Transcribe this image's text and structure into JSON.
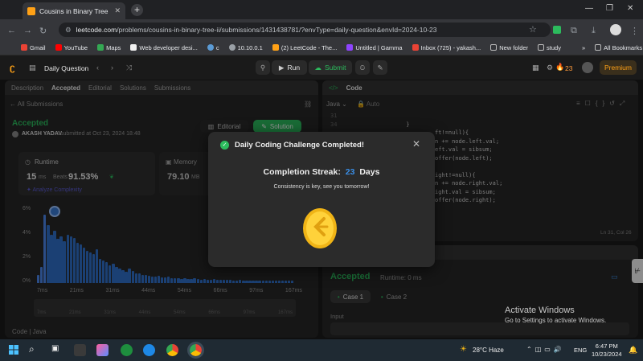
{
  "browser": {
    "tab_title": "Cousins in Binary Tree II - LeetC",
    "url_host": "leetcode.com",
    "url_path": "/problems/cousins-in-binary-tree-ii/submissions/1431438781/?envType=daily-question&envId=2024-10-23",
    "bookmarks": [
      "Gmail",
      "YouTube",
      "Maps",
      "Web developer desi...",
      "c",
      "10.10.0.1",
      "(2) LeetCode - The...",
      "Untitled | Gamma",
      "Inbox (725) - yakash...",
      "New folder",
      "study"
    ],
    "all_bookmarks": "All Bookmarks"
  },
  "header": {
    "daily_question": "Daily Question",
    "run": "Run",
    "submit": "Submit",
    "streak_count": "23",
    "premium": "Premium"
  },
  "left_panel": {
    "tabs": [
      "Description",
      "Accepted",
      "Editorial",
      "Solutions",
      "Submissions"
    ],
    "all_submissions": "All Submissions",
    "status": "Accepted",
    "user": "AKASH YADAV",
    "submitted_text": "submitted at Oct 23, 2024 18:48",
    "editorial_btn": "Editorial",
    "solution_btn": "Solution",
    "runtime_label": "Runtime",
    "runtime_value": "15",
    "runtime_unit": "ms",
    "beats_label": "Beats",
    "beats_value": "91.53%",
    "memory_label": "Memory",
    "memory_value": "79.10",
    "memory_unit": "MB",
    "analyze": "Analyze Complexity",
    "y_ticks": [
      "6%",
      "4%",
      "2%",
      "0%"
    ],
    "x_ticks": [
      "7ms",
      "21ms",
      "31ms",
      "44ms",
      "54ms",
      "66ms",
      "97ms",
      "167ms"
    ],
    "bottom_label": "Code | Java"
  },
  "editor": {
    "title": "Code",
    "language": "Java",
    "auto": "Auto",
    "lines": [
      {
        "n": "31",
        "t": ""
      },
      {
        "n": "34",
        "t": "    }"
      },
      {
        "n": "",
        "t": "ft!=null){"
      },
      {
        "n": "",
        "t": "n += node.left.val;"
      },
      {
        "n": "",
        "t": "eft.val = sibsum;"
      },
      {
        "n": "",
        "t": "offer(node.left);"
      },
      {
        "n": "",
        "t": ""
      },
      {
        "n": "",
        "t": "ight!=null){"
      },
      {
        "n": "",
        "t": "n += node.right.val;"
      },
      {
        "n": "",
        "t": "ight.val = sibsum;"
      },
      {
        "n": "",
        "t": "offer(node.right);"
      }
    ],
    "cursor": "Ln 31, Col 26"
  },
  "result_panel": {
    "status": "Accepted",
    "runtime": "Runtime: 0 ms",
    "case1": "Case 1",
    "case2": "Case 2",
    "input_label": "Input"
  },
  "modal": {
    "title": "Daily Coding Challenge Completed!",
    "streak_label": "Completion Streak:",
    "streak_value": "23",
    "streak_unit": "Days",
    "message": "Consistency is key, see you tomorrow!"
  },
  "watermark": {
    "line1": "Activate Windows",
    "line2": "Go to Settings to activate Windows."
  },
  "taskbar": {
    "weather": "28°C  Haze",
    "lang": "ENG",
    "time": "6:47 PM",
    "date": "10/23/2024"
  },
  "colors": {
    "accent_green": "#2cbb5d",
    "brand_orange": "#ffa116",
    "streak_blue": "#3a8ee6"
  }
}
